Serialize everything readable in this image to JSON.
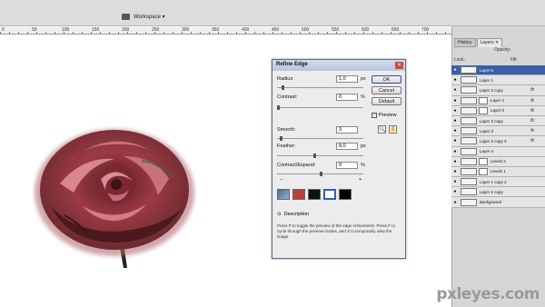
{
  "menubar": {
    "workspace_label": "Workspace ▾"
  },
  "ruler": {
    "ticks": [
      "0",
      "50",
      "100",
      "150",
      "200",
      "250",
      "300",
      "350",
      "400",
      "450",
      "500",
      "550",
      "600",
      "650",
      "700"
    ]
  },
  "panel": {
    "tabs": [
      "History",
      "Layers ✕"
    ],
    "opacity_label": "Opacity:",
    "lock_label": "Lock:",
    "fill_label": "Fill:",
    "layers": [
      {
        "name": "Layer 5",
        "selected": true,
        "mask": false,
        "fx": ""
      },
      {
        "name": "Layer 1",
        "selected": false,
        "mask": false,
        "fx": ""
      },
      {
        "name": "Layer 2 copy",
        "selected": false,
        "mask": false,
        "fx": "fx"
      },
      {
        "name": "Layer 2",
        "selected": false,
        "mask": true,
        "fx": "fx"
      },
      {
        "name": "Layer 0",
        "selected": false,
        "mask": true,
        "fx": "fx"
      },
      {
        "name": "Layer 3 copy",
        "selected": false,
        "mask": false,
        "fx": "fx"
      },
      {
        "name": "Layer 3",
        "selected": false,
        "mask": false,
        "fx": "fx"
      },
      {
        "name": "Layer 2 copy 3",
        "selected": false,
        "mask": false,
        "fx": "fx"
      },
      {
        "name": "Layer 4",
        "selected": false,
        "mask": false,
        "fx": ""
      },
      {
        "name": "Levels 2",
        "selected": false,
        "mask": true,
        "fx": ""
      },
      {
        "name": "Levels 1",
        "selected": false,
        "mask": true,
        "fx": ""
      },
      {
        "name": "Layer 1 copy 2",
        "selected": false,
        "mask": false,
        "fx": ""
      },
      {
        "name": "Layer 1 copy",
        "selected": false,
        "mask": false,
        "fx": ""
      },
      {
        "name": "Background",
        "selected": false,
        "mask": false,
        "fx": ""
      }
    ]
  },
  "dialog": {
    "title": "Refine Edge",
    "close": "✕",
    "radius_label": "Radius:",
    "radius_value": "1,0",
    "radius_unit": "px",
    "contrast_label": "Contrast:",
    "contrast_value": "0",
    "contrast_unit": "%",
    "smooth_label": "Smooth:",
    "smooth_value": "3",
    "feather_label": "Feather:",
    "feather_value": "8,0",
    "feather_unit": "px",
    "expand_label": "Contract/Expand:",
    "expand_value": "0",
    "expand_unit": "%",
    "minus": "−",
    "plus": "+",
    "ok": "OK",
    "cancel": "Cancel",
    "default": "Default",
    "preview_label": "Preview",
    "preview_check": "✓",
    "description_label": "Description",
    "description_text": "Press P to toggle the preview of the edge refinements. Press F to cycle through the preview modes, and X to temporarily view the image."
  },
  "watermark": "pxleyes.com"
}
